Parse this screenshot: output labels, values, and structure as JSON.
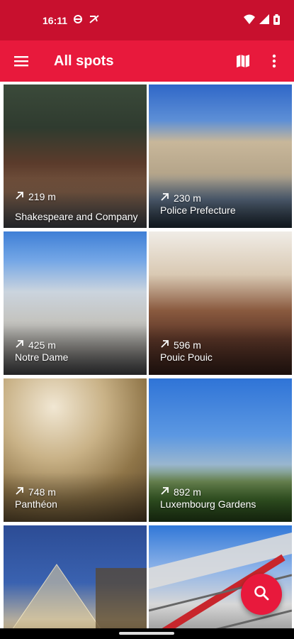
{
  "status_bar": {
    "time": "16:11",
    "icons": [
      "data-saver-icon",
      "no-call-icon",
      "wifi-icon",
      "signal-icon",
      "battery-icon"
    ]
  },
  "app_bar": {
    "title": "All spots",
    "icons": [
      "menu-icon",
      "map-icon",
      "more-vert-icon"
    ]
  },
  "spots": [
    {
      "distance": "219 m",
      "name": "Shakespeare and Company"
    },
    {
      "distance": "230 m",
      "name": "Police Prefecture"
    },
    {
      "distance": "425 m",
      "name": "Notre Dame"
    },
    {
      "distance": "596 m",
      "name": "Pouic Pouic"
    },
    {
      "distance": "748 m",
      "name": "Panthéon"
    },
    {
      "distance": "892 m",
      "name": "Luxembourg Gardens"
    },
    {
      "distance": "",
      "name": ""
    },
    {
      "distance": "",
      "name": ""
    }
  ],
  "fab": {
    "icon": "search-icon"
  },
  "colors": {
    "status_bar": "#c8102e",
    "app_bar": "#e8193c",
    "fab": "#e8193c"
  }
}
